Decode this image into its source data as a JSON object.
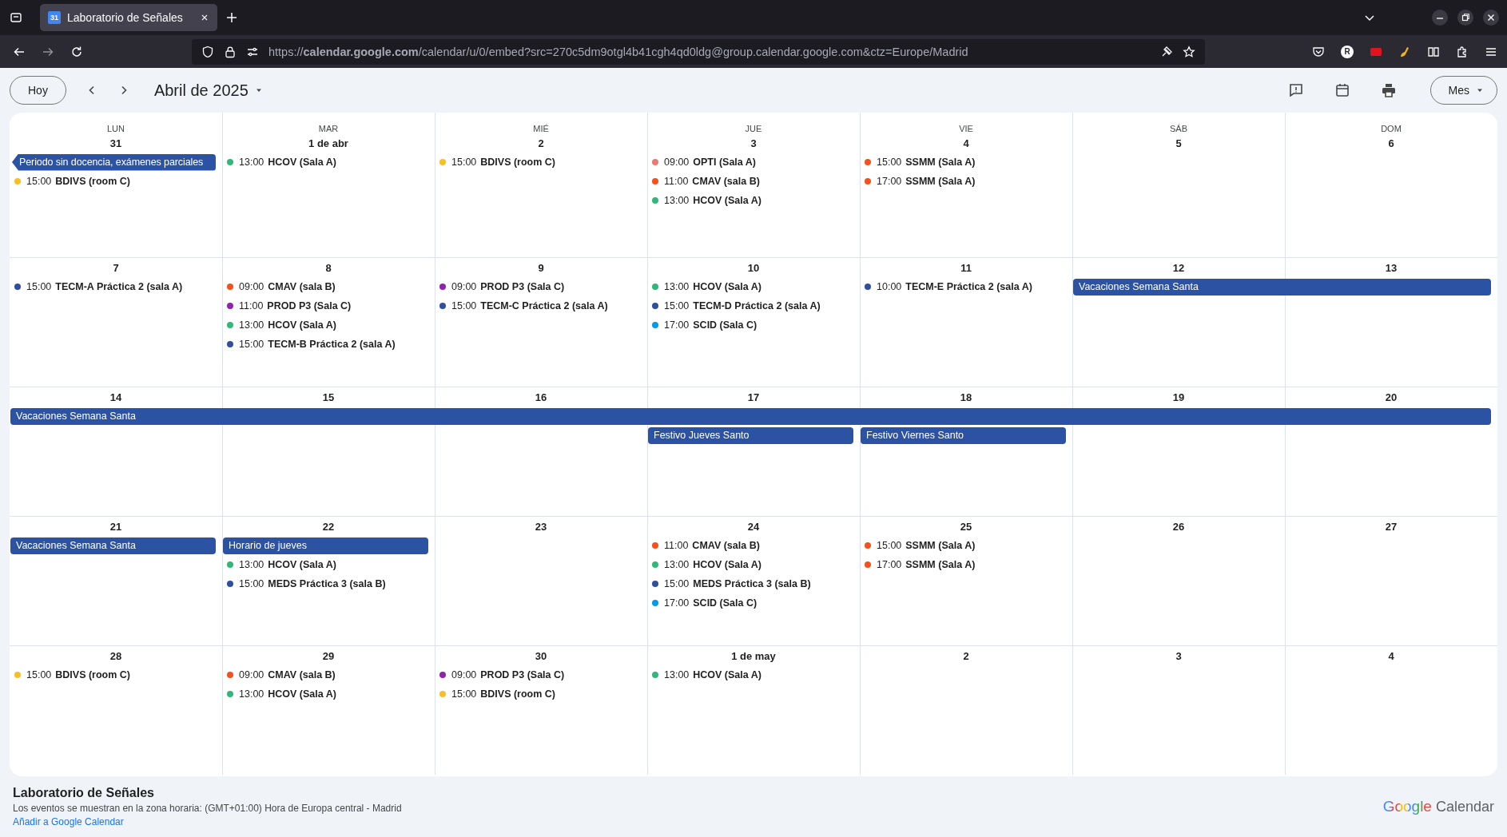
{
  "browser": {
    "tab_title": "Laboratorio de Señales",
    "favicon_label": "31",
    "url": "https://**calendar.google.com**/calendar/u/0/embed?src=270c5dm9otgl4b41cgh4qd0ldg@group.calendar.google.com&ctz=Europe/Madrid",
    "avatar_letter": "R"
  },
  "toolbar": {
    "today_button": "Hoy",
    "month_label": "Abril de 2025",
    "view_button": "Mes"
  },
  "weekdays": [
    "LUN",
    "MAR",
    "MIÉ",
    "JUE",
    "VIE",
    "SÁB",
    "DOM"
  ],
  "weeks": [
    {
      "days": [
        {
          "date": "31",
          "all_day": [
            {
              "kind": "start",
              "title": "Periodo sin docencia, exámenes parciales",
              "continues_from_previous_week": true
            }
          ],
          "events": [
            {
              "time": "15:00",
              "title": "BDIVS (room C)",
              "color": "#f6bf26"
            }
          ]
        },
        {
          "date": "1 de abr",
          "events": [
            {
              "time": "13:00",
              "title": "HCOV (Sala A)",
              "color": "#33b679"
            }
          ]
        },
        {
          "date": "2",
          "events": [
            {
              "time": "15:00",
              "title": "BDIVS (room C)",
              "color": "#f6bf26"
            }
          ]
        },
        {
          "date": "3",
          "events": [
            {
              "time": "09:00",
              "title": "OPTI (Sala A)",
              "color": "#e67c73"
            },
            {
              "time": "11:00",
              "title": "CMAV (sala B)",
              "color": "#f4511e"
            },
            {
              "time": "13:00",
              "title": "HCOV (Sala A)",
              "color": "#33b679"
            }
          ]
        },
        {
          "date": "4",
          "events": [
            {
              "time": "15:00",
              "title": "SSMM (Sala A)",
              "color": "#f4511e"
            },
            {
              "time": "17:00",
              "title": "SSMM (Sala A)",
              "color": "#f4511e"
            }
          ]
        },
        {
          "date": "5"
        },
        {
          "date": "6"
        }
      ]
    },
    {
      "days": [
        {
          "date": "7",
          "events": [
            {
              "time": "15:00",
              "title": "TECM-A Práctica 2 (sala A)",
              "color": "#2f4f9e"
            }
          ]
        },
        {
          "date": "8",
          "events": [
            {
              "time": "09:00",
              "title": "CMAV (sala B)",
              "color": "#f4511e"
            },
            {
              "time": "11:00",
              "title": "PROD P3 (Sala C)",
              "color": "#8e24aa"
            },
            {
              "time": "13:00",
              "title": "HCOV (Sala A)",
              "color": "#33b679"
            },
            {
              "time": "15:00",
              "title": "TECM-B Práctica 2 (sala A)",
              "color": "#2f4f9e"
            }
          ]
        },
        {
          "date": "9",
          "events": [
            {
              "time": "09:00",
              "title": "PROD P3 (Sala C)",
              "color": "#8e24aa"
            },
            {
              "time": "15:00",
              "title": "TECM-C Práctica 2 (sala A)",
              "color": "#2f4f9e"
            }
          ]
        },
        {
          "date": "10",
          "events": [
            {
              "time": "13:00",
              "title": "HCOV (Sala A)",
              "color": "#33b679"
            },
            {
              "time": "15:00",
              "title": "TECM-D Práctica 2 (sala A)",
              "color": "#2f4f9e"
            },
            {
              "time": "17:00",
              "title": "SCID (Sala C)",
              "color": "#039be5"
            }
          ]
        },
        {
          "date": "11",
          "events": [
            {
              "time": "10:00",
              "title": "TECM-E Práctica 2 (sala A)",
              "color": "#2f4f9e"
            }
          ]
        },
        {
          "date": "12",
          "all_day": [
            {
              "kind": "start",
              "title": "Vacaciones Semana Santa",
              "continues_from_previous_week": false
            }
          ]
        },
        {
          "date": "13",
          "all_day": [
            {
              "kind": "continue"
            }
          ]
        }
      ]
    },
    {
      "days": [
        {
          "date": "14",
          "all_day": [
            {
              "kind": "start",
              "title": "Vacaciones Semana Santa",
              "continues_from_previous_week": false
            }
          ]
        },
        {
          "date": "15",
          "all_day": [
            {
              "kind": "continue"
            }
          ]
        },
        {
          "date": "16",
          "all_day": [
            {
              "kind": "continue"
            }
          ]
        },
        {
          "date": "17",
          "all_day": [
            {
              "kind": "continue"
            },
            {
              "kind": "start",
              "title": "Festivo Jueves Santo",
              "continues_from_previous_week": false
            }
          ]
        },
        {
          "date": "18",
          "all_day": [
            {
              "kind": "continue"
            },
            {
              "kind": "start",
              "title": "Festivo Viernes Santo",
              "continues_from_previous_week": false
            }
          ]
        },
        {
          "date": "19",
          "all_day": [
            {
              "kind": "continue"
            }
          ]
        },
        {
          "date": "20",
          "all_day": [
            {
              "kind": "continue"
            }
          ]
        }
      ]
    },
    {
      "days": [
        {
          "date": "21",
          "all_day": [
            {
              "kind": "start",
              "title": "Vacaciones Semana Santa",
              "continues_from_previous_week": false
            }
          ]
        },
        {
          "date": "22",
          "all_day": [
            {
              "kind": "start",
              "title": "Horario de jueves",
              "continues_from_previous_week": false
            }
          ],
          "events": [
            {
              "time": "13:00",
              "title": "HCOV (Sala A)",
              "color": "#33b679"
            },
            {
              "time": "15:00",
              "title": "MEDS Práctica 3 (sala B)",
              "color": "#2f4f9e"
            }
          ]
        },
        {
          "date": "23"
        },
        {
          "date": "24",
          "events": [
            {
              "time": "11:00",
              "title": "CMAV (sala B)",
              "color": "#f4511e"
            },
            {
              "time": "13:00",
              "title": "HCOV (Sala A)",
              "color": "#33b679"
            },
            {
              "time": "15:00",
              "title": "MEDS Práctica 3 (sala B)",
              "color": "#2f4f9e"
            },
            {
              "time": "17:00",
              "title": "SCID (Sala C)",
              "color": "#039be5"
            }
          ]
        },
        {
          "date": "25",
          "events": [
            {
              "time": "15:00",
              "title": "SSMM (Sala A)",
              "color": "#f4511e"
            },
            {
              "time": "17:00",
              "title": "SSMM (Sala A)",
              "color": "#f4511e"
            }
          ]
        },
        {
          "date": "26"
        },
        {
          "date": "27"
        }
      ]
    },
    {
      "days": [
        {
          "date": "28",
          "events": [
            {
              "time": "15:00",
              "title": "BDIVS (room C)",
              "color": "#f6bf26"
            }
          ]
        },
        {
          "date": "29",
          "events": [
            {
              "time": "09:00",
              "title": "CMAV (sala B)",
              "color": "#f4511e"
            },
            {
              "time": "13:00",
              "title": "HCOV (Sala A)",
              "color": "#33b679"
            }
          ]
        },
        {
          "date": "30",
          "events": [
            {
              "time": "09:00",
              "title": "PROD P3 (Sala C)",
              "color": "#8e24aa"
            },
            {
              "time": "15:00",
              "title": "BDIVS (room C)",
              "color": "#f6bf26"
            }
          ]
        },
        {
          "date": "1 de may",
          "events": [
            {
              "time": "13:00",
              "title": "HCOV (Sala A)",
              "color": "#33b679"
            }
          ]
        },
        {
          "date": "2"
        },
        {
          "date": "3"
        },
        {
          "date": "4"
        }
      ]
    }
  ],
  "footer": {
    "title": "Laboratorio de Señales",
    "timezone_note": "Los eventos se muestran en la zona horaria: (GMT+01:00) Hora de Europa central - Madrid",
    "add_link": "Añadir a Google Calendar",
    "logo": {
      "brand": "Google",
      "product": "Calendar"
    }
  }
}
